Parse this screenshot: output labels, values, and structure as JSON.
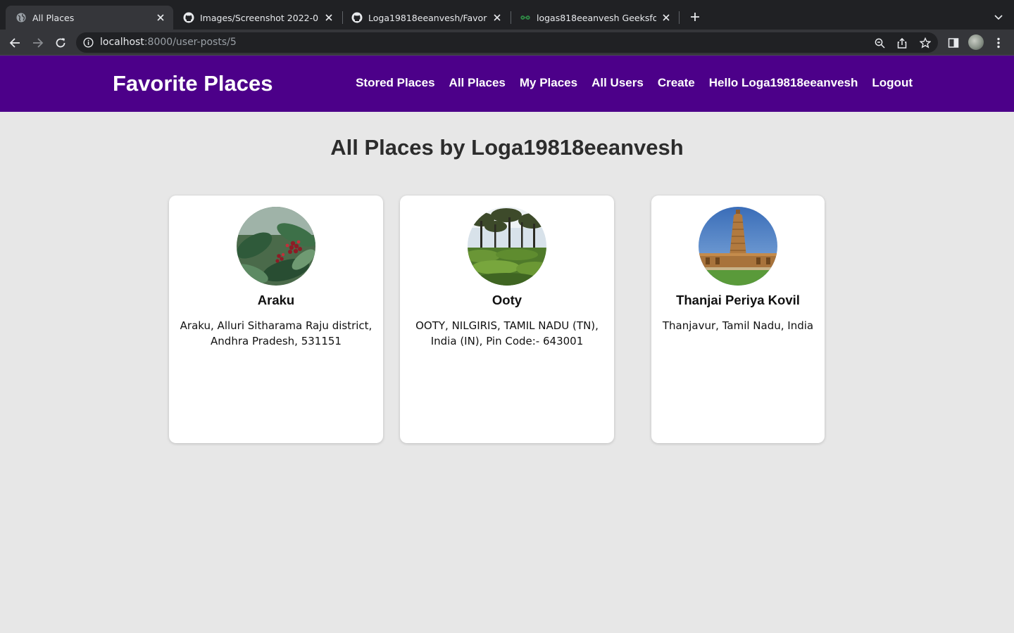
{
  "browser": {
    "tabs": [
      {
        "title": "All Places",
        "active": true,
        "favicon": "globe-icon"
      },
      {
        "title": "Images/Screenshot 2022-05-0",
        "active": false,
        "favicon": "github-icon"
      },
      {
        "title": "Loga19818eeanvesh/Favorite_I",
        "active": false,
        "favicon": "github-icon"
      },
      {
        "title": "logas818eeanvesh GeeksforGe",
        "active": false,
        "favicon": "geeksforgeeks-icon"
      }
    ],
    "url_host": "localhost",
    "url_path": ":8000/user-posts/5"
  },
  "site": {
    "brand": "Favorite Places",
    "nav": [
      "Stored Places",
      "All Places",
      "My Places",
      "All Users",
      "Create",
      "Hello Loga19818eeanvesh",
      "Logout"
    ],
    "brand_color": "#4c0089"
  },
  "page": {
    "title": "All Places by Loga19818eeanvesh",
    "places": [
      {
        "name": "Araku",
        "address": "Araku, Alluri Sitharama Raju district, Andhra Pradesh, 531151",
        "image": "coffee-berries-photo"
      },
      {
        "name": "Ooty",
        "address": "OOTY, NILGIRIS, TAMIL NADU (TN), India (IN), Pin Code:- 643001",
        "image": "tea-garden-photo"
      },
      {
        "name": "Thanjai Periya Kovil",
        "address": "Thanjavur, Tamil Nadu, India",
        "image": "temple-photo"
      }
    ]
  }
}
